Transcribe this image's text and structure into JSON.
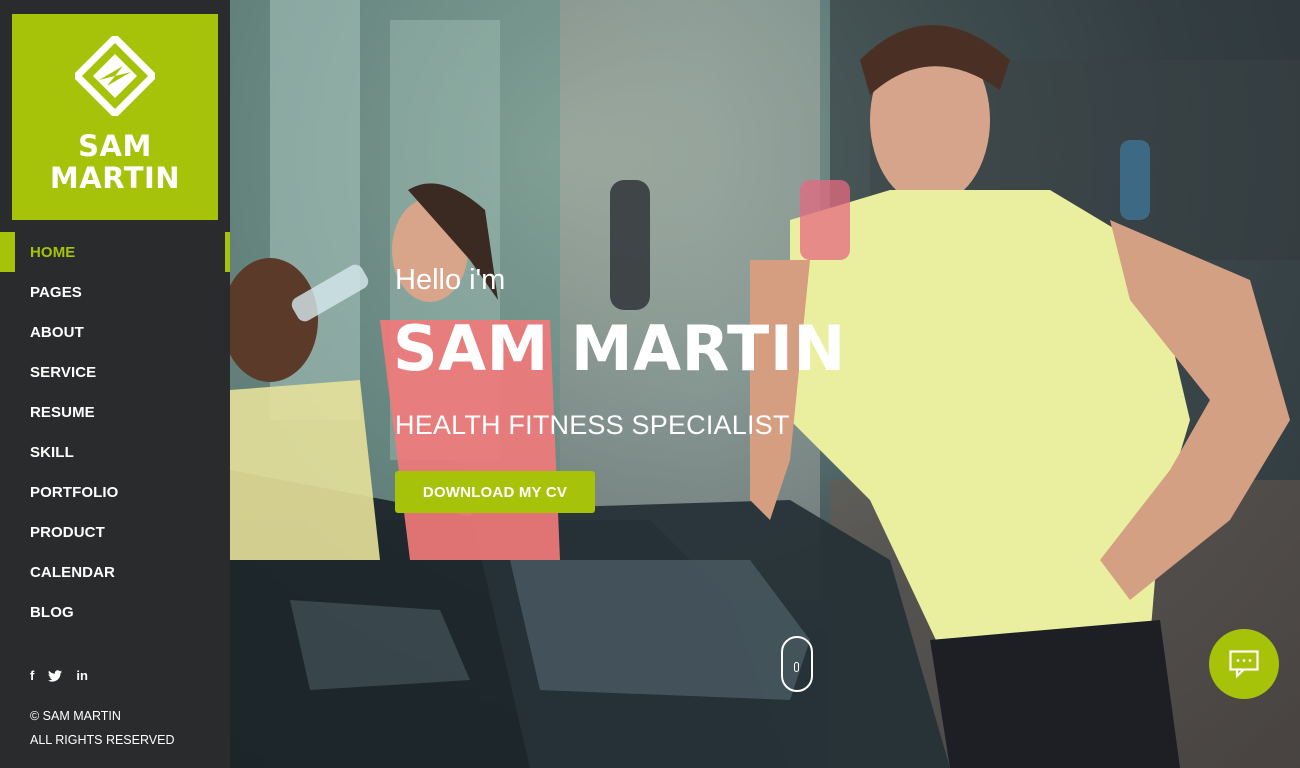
{
  "brand": {
    "line1": "SAM",
    "line2": "MARTIN",
    "icon": "diamond-logo-icon",
    "accent": "#a6c30a"
  },
  "nav": {
    "items": [
      {
        "label": "HOME",
        "active": true
      },
      {
        "label": "PAGES",
        "active": false
      },
      {
        "label": "ABOUT",
        "active": false
      },
      {
        "label": "SERVICE",
        "active": false
      },
      {
        "label": "RESUME",
        "active": false
      },
      {
        "label": "SKILL",
        "active": false
      },
      {
        "label": "PORTFOLIO",
        "active": false
      },
      {
        "label": "PRODUCT",
        "active": false
      },
      {
        "label": "CALENDAR",
        "active": false
      },
      {
        "label": "BLOG",
        "active": false
      }
    ]
  },
  "social": {
    "facebook": "f",
    "twitter": "twitter-icon",
    "linkedin": "in"
  },
  "footer": {
    "copyright": "© SAM MARTIN",
    "rights": "ALL RIGHTS RESERVED"
  },
  "hero": {
    "greeting": "Hello i'm",
    "name": "SAM MARTIN",
    "title": "HEALTH FITNESS SPECIALIST",
    "button_label": "DOWNLOAD MY CV",
    "scroll_icon": "mouse-scroll-icon",
    "chat_icon": "chat-bubble-icon"
  }
}
